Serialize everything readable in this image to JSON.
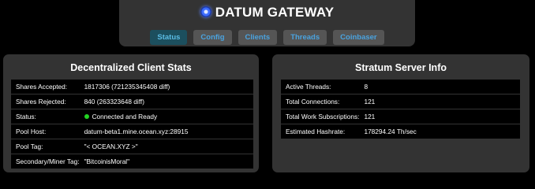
{
  "header": {
    "title": "DATUM GATEWAY",
    "logo_icon": "datum-logo-icon"
  },
  "nav": {
    "tabs": [
      "Status",
      "Config",
      "Clients",
      "Threads",
      "Coinbaser"
    ],
    "active": "Status"
  },
  "client_stats": {
    "title": "Decentralized Client Stats",
    "rows": [
      {
        "label": "Shares Accepted:",
        "value": "1817306 (721235345408 diff)"
      },
      {
        "label": "Shares Rejected:",
        "value": "840 (263323648 diff)"
      },
      {
        "label": "Status:",
        "value": "Connected and Ready"
      },
      {
        "label": "Pool Host:",
        "value": "datum-beta1.mine.ocean.xyz:28915"
      },
      {
        "label": "Pool Tag:",
        "value": "\"< OCEAN.XYZ >\""
      },
      {
        "label": "Secondary/Miner Tag:",
        "value": "\"BitcoinisMoral\""
      }
    ],
    "status_color": "#22d322"
  },
  "stratum": {
    "title": "Stratum Server Info",
    "rows": [
      {
        "label": "Active Threads:",
        "value": "8"
      },
      {
        "label": "Total Connections:",
        "value": "121"
      },
      {
        "label": "Total Work Subscriptions:",
        "value": "121"
      },
      {
        "label": "Estimated Hashrate:",
        "value": "178294.24 Th/sec"
      }
    ]
  }
}
